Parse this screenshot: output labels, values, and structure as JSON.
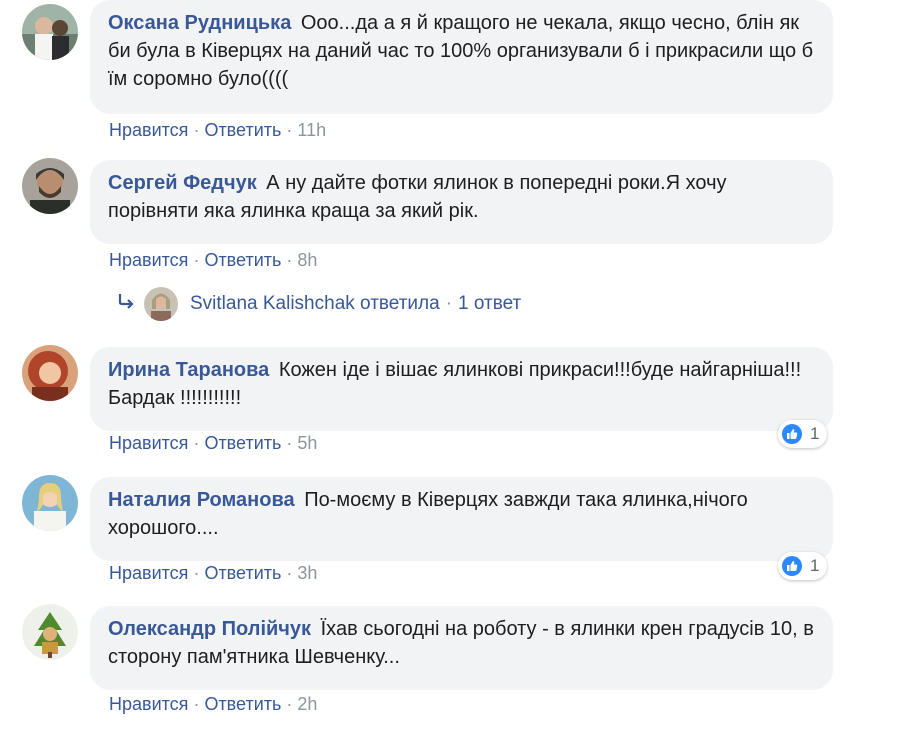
{
  "actions": {
    "like": "Нравится",
    "reply": "Ответить",
    "sep": "·"
  },
  "comments": [
    {
      "author": "Оксана Рудницька",
      "text": "Ооо...да а я й кращого не чекала, якщо чесно, блін як би була в Ківерцях на даний час то 100% организували б і прикрасили що б їм соромно було((((",
      "time": "11h"
    },
    {
      "author": "Сергей Федчук",
      "text": "А ну дайте фотки ялинок в попередні роки.Я хочу порівняти яка ялинка краща за який рік.",
      "time": "8h"
    },
    {
      "author": "Ирина Таранова",
      "text": "Кожен іде і вішає ялинкові прикраси!!!буде найгарніша!!! Бардак !!!!!!!!!!!",
      "time": "5h",
      "reactions": "1"
    },
    {
      "author": "Наталия Романова",
      "text": "По-моєму в Ківерцях завжди така ялинка,нічого хорошого....",
      "time": "3h",
      "reactions": "1"
    },
    {
      "author": "Олександр Полійчук",
      "text": "Їхав сьогодні на роботу - в ялинки крен градусів 10, в сторону пам'ятника Шевченку...",
      "time": "2h"
    }
  ],
  "reply_summary": {
    "name": "Svitlana Kalishchak",
    "verb": "ответила",
    "sep": "·",
    "count": "1 ответ"
  },
  "colors": {
    "link": "#385898",
    "muted": "#8d949e",
    "bubble": "#f2f3f5",
    "like": "#2d88ff"
  },
  "icons": [
    "reply-arrow-icon",
    "like-icon"
  ]
}
